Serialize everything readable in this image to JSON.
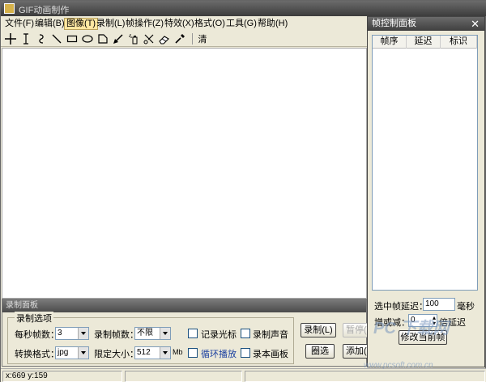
{
  "window": {
    "title": "GIF动画制作"
  },
  "menu": [
    {
      "label": "文件(F)"
    },
    {
      "label": "编辑(B)"
    },
    {
      "label": "图像(T)"
    },
    {
      "label": "录制(L)"
    },
    {
      "label": "帧操作(Z)"
    },
    {
      "label": "特效(X)"
    },
    {
      "label": "格式(O)"
    },
    {
      "label": "工具(G)"
    },
    {
      "label": "帮助(H)"
    }
  ],
  "toolbar": {
    "icons": [
      "crosshair-icon",
      "text-cursor-icon",
      "curve-icon",
      "line-icon",
      "rectangle-icon",
      "ellipse-icon",
      "polygon-icon",
      "arrow-icon",
      "spray-icon",
      "scissors-icon",
      "eraser-icon",
      "eyedropper-icon"
    ],
    "clear_label": "清"
  },
  "record_panel": {
    "title": "录制面板",
    "group_title": "录制选项",
    "fps_label": "每秒帧数：",
    "fps_value": "3",
    "frames_label": "录制帧数：",
    "frames_value": "不限",
    "format_label": "转换格式：",
    "format_value": "jpg",
    "size_label": "限定大小：",
    "size_value": "512",
    "size_unit": "Mb",
    "record_cursor": "记录光标",
    "record_sound": "录制声音",
    "loop_play": "循环播放",
    "record_clipboard": "录本画板",
    "record_button": "录制(L)",
    "pause_button": "暂停(",
    "select_button": "圈选",
    "add_button": "添加("
  },
  "frame_panel": {
    "title": "帧控制面板",
    "columns": [
      "帧序",
      "延迟",
      "标识"
    ],
    "delay_label": "选中帧延迟：",
    "delay_value": "100",
    "delay_unit": "毫秒",
    "step_label": "增或减：",
    "step_value": "0",
    "step_unit": "倍延迟",
    "modify_button": "修改当前帧"
  },
  "status": {
    "coords": "x:669 y:159"
  },
  "watermark": {
    "text": "PC 下载网",
    "url": "www.pcsoft.com.cn"
  }
}
